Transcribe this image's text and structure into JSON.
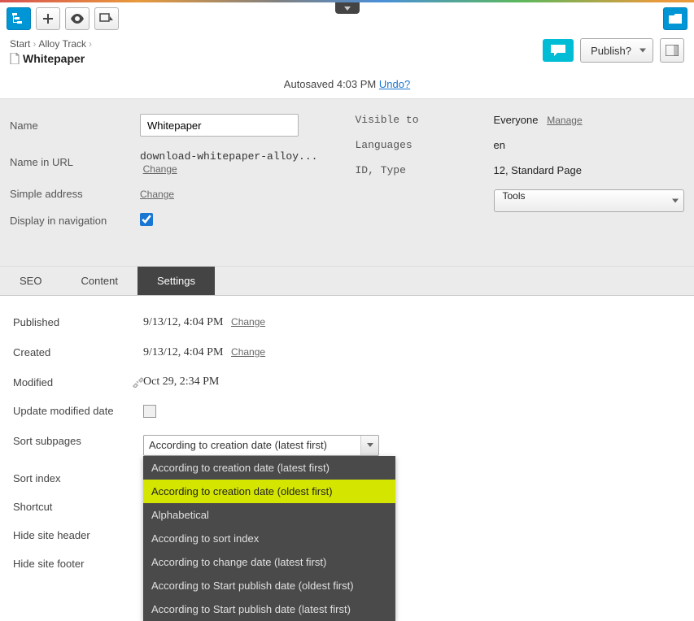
{
  "breadcrumb": {
    "items": [
      "Start",
      "Alloy Track"
    ],
    "title": "Whitepaper"
  },
  "publish": {
    "label": "Publish?"
  },
  "autosave": {
    "text": "Autosaved 4:03 PM",
    "undo": "Undo?"
  },
  "form": {
    "left": {
      "name_label": "Name",
      "name_value": "Whitepaper",
      "url_label": "Name in URL",
      "url_value": "download-whitepaper-alloy...",
      "url_change": "Change",
      "simple_label": "Simple address",
      "simple_change": "Change",
      "display_label": "Display in navigation",
      "display_checked": true
    },
    "right": {
      "visible_label": "Visible to",
      "visible_value": "Everyone",
      "manage": "Manage",
      "lang_label": "Languages",
      "lang_value": "en",
      "idtype_label": "ID, Type",
      "idtype_value": "12, Standard Page",
      "tools": "Tools"
    }
  },
  "tabs": [
    "SEO",
    "Content",
    "Settings"
  ],
  "active_tab": 2,
  "settings": {
    "published_label": "Published",
    "published_value": "9/13/12, 4:04 PM",
    "published_change": "Change",
    "created_label": "Created",
    "created_value": "9/13/12, 4:04 PM",
    "created_change": "Change",
    "modified_label": "Modified",
    "modified_value": "Oct 29, 2:34 PM",
    "update_label": "Update modified date",
    "sort_label": "Sort subpages",
    "sort_selected": "According to creation date (latest first)",
    "sort_options": [
      "According to creation date (latest first)",
      "According to creation date (oldest first)",
      "Alphabetical",
      "According to sort index",
      "According to change date (latest first)",
      "According to Start publish date (oldest first)",
      "According to Start publish date (latest first)"
    ],
    "sort_highlight": 1,
    "sort_index_label": "Sort index",
    "shortcut_label": "Shortcut",
    "hide_header_label": "Hide site header",
    "hide_footer_label": "Hide site footer"
  }
}
